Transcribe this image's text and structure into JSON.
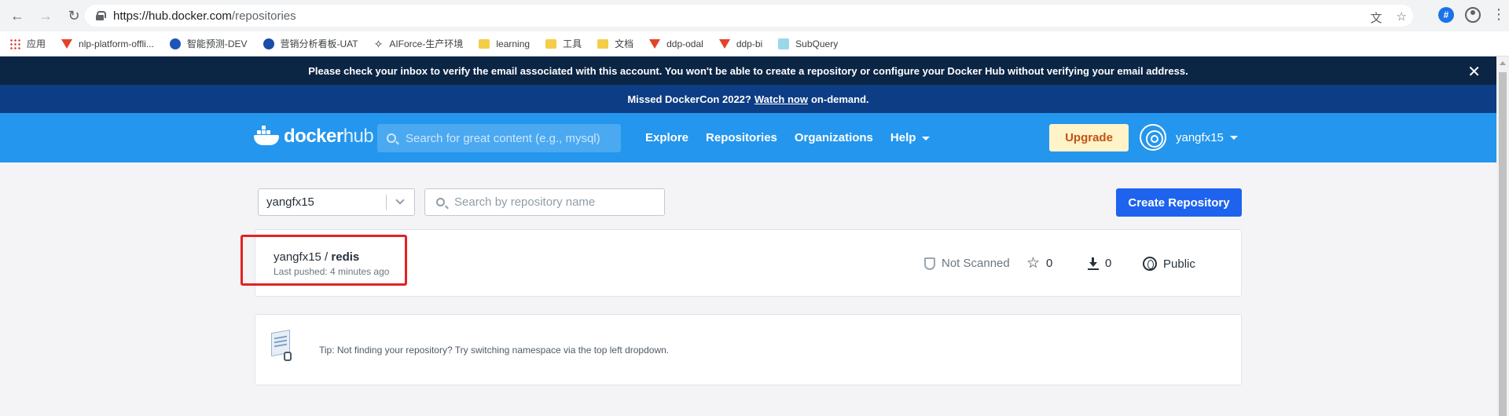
{
  "browser": {
    "url_host": "https://hub.docker.com",
    "url_path": "/repositories",
    "bookmarks": [
      {
        "label": "应用",
        "icon": "apps-icon"
      },
      {
        "label": "nlp-platform-offli...",
        "icon": "gitlab-icon"
      },
      {
        "label": "智能预测-DEV",
        "icon": "site-icon"
      },
      {
        "label": "营销分析看板-UAT",
        "icon": "site-icon"
      },
      {
        "label": "AIForce-生产环境",
        "icon": "aiforce-icon"
      },
      {
        "label": "learning",
        "icon": "folder-icon"
      },
      {
        "label": "工具",
        "icon": "folder-icon"
      },
      {
        "label": "文档",
        "icon": "folder-icon"
      },
      {
        "label": "ddp-odal",
        "icon": "gitlab-icon"
      },
      {
        "label": "ddp-bi",
        "icon": "gitlab-icon"
      },
      {
        "label": "SubQuery",
        "icon": "subquery-icon"
      }
    ]
  },
  "banners": {
    "verify": "Please check your inbox to verify the email associated with this account. You won't be able to create a repository or configure your Docker Hub without verifying your email address.",
    "dockercon_prefix": "Missed DockerCon 2022?",
    "dockercon_link": "Watch now",
    "dockercon_suffix": "on-demand."
  },
  "header": {
    "logo_docker": "docker",
    "logo_hub": "hub",
    "search_placeholder": "Search for great content (e.g., mysql)",
    "nav": [
      "Explore",
      "Repositories",
      "Organizations",
      "Help"
    ],
    "upgrade": "Upgrade",
    "username": "yangfx15"
  },
  "toolbar": {
    "namespace": "yangfx15",
    "repo_search_placeholder": "Search by repository name",
    "create_button": "Create Repository"
  },
  "repositories": [
    {
      "namespace": "yangfx15",
      "separator": " / ",
      "name": "redis",
      "last_pushed": "Last pushed: 4 minutes ago",
      "scan_status": "Not Scanned",
      "stars": "0",
      "pulls": "0",
      "visibility": "Public"
    }
  ],
  "tip": {
    "text": "Tip: Not finding your repository? Try switching namespace via the top left dropdown."
  },
  "colors": {
    "docker_blue": "#2496ed",
    "banner_dark": "#0b2545",
    "banner_mid": "#0d3d84",
    "create_button": "#1d63ed",
    "upgrade_bg": "#fff3c7",
    "highlight_red": "#e32222"
  }
}
